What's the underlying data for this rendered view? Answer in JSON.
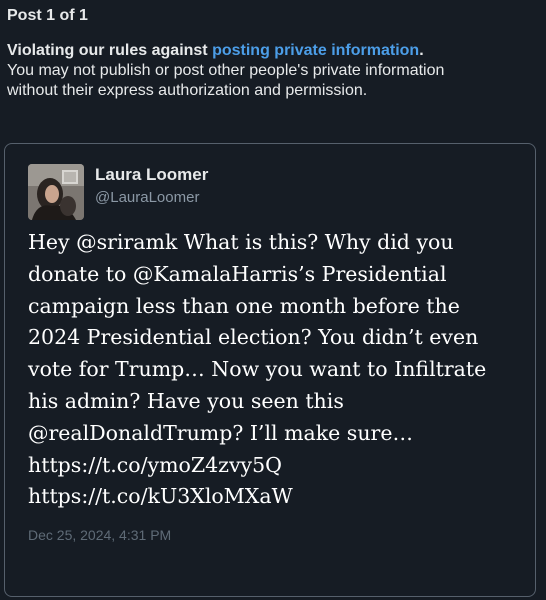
{
  "header": {
    "post_counter": "Post 1 of 1",
    "violation_prefix": "Violating our rules against ",
    "violation_link": "posting private information",
    "violation_suffix": ".",
    "description_line1": "You may not publish or post other people's private information",
    "description_line2": "without their express authorization and permission."
  },
  "tweet": {
    "author_name": "Laura Loomer",
    "author_handle": "@LauraLoomer",
    "avatar_icon": "profile-photo",
    "lines": [
      "Hey @sriramk What is this? Why did you",
      "donate to @KamalaHarris’s Presidential",
      "campaign less than one month before the",
      "2024 Presidential election? You didn’t even",
      "vote for Trump… Now you want to Infiltrate",
      "his admin? Have you seen this",
      "@realDonaldTrump? I’ll make sure…",
      "https://t.co/ymoZ4zvy5Q",
      "https://t.co/kU3XloMXaW"
    ],
    "timestamp": "Dec 25, 2024, 4:31 PM"
  },
  "colors": {
    "background": "#161c24",
    "link": "#4c9ee8",
    "border": "#56606c",
    "muted": "#8b98a5"
  }
}
